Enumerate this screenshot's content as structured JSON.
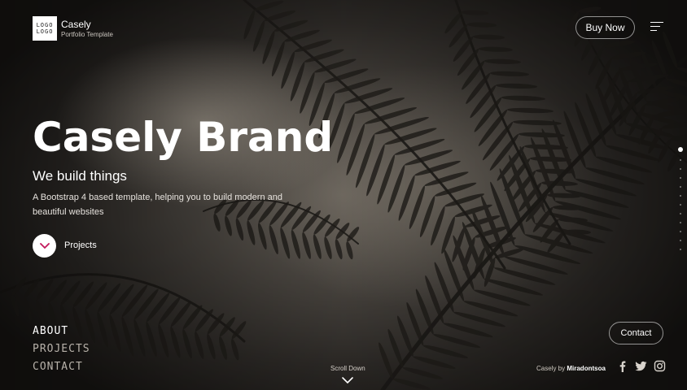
{
  "brand": {
    "logo_line1": "LOGO",
    "logo_line2": "LOGO",
    "name": "Casely",
    "tagline": "Portfolio Template"
  },
  "header": {
    "buy_label": "Buy Now",
    "menu_icon": "hamburger-menu-icon"
  },
  "hero": {
    "title": "Casely Brand",
    "subtitle": "We build things",
    "description": "A Bootstrap 4 based template, helping you to build modern and beautiful websites",
    "projects_label": "Projects",
    "projects_icon": "chevron-down-icon",
    "accent_color": "#c2185b"
  },
  "pagination": {
    "count": 12,
    "active_index": 0
  },
  "bottom_nav": {
    "items": [
      "ABOUT",
      "PROJECTS",
      "CONTACT"
    ]
  },
  "scroll": {
    "label": "Scroll Down",
    "icon": "chevron-down-icon"
  },
  "footer": {
    "contact_label": "Contact",
    "credit_prefix": "Casely by",
    "credit_author": "Miradontsoa",
    "socials": [
      "facebook-icon",
      "twitter-icon",
      "instagram-icon"
    ]
  }
}
